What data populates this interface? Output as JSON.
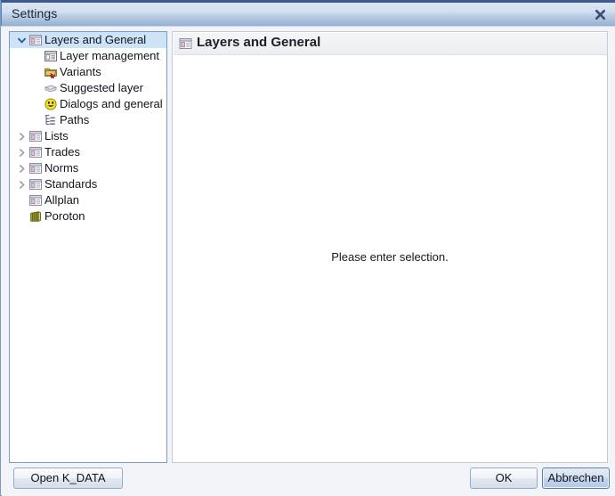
{
  "window": {
    "title": "Settings",
    "close_icon": "close-icon"
  },
  "tree": {
    "items": [
      {
        "label": "Layers and General",
        "icon": "window-layout-icon",
        "level": 0,
        "state": "expanded",
        "selected": true
      },
      {
        "label": "Layer management",
        "icon": "layer-management-icon",
        "level": 1,
        "state": "leaf",
        "selected": false
      },
      {
        "label": "Variants",
        "icon": "folder-variants-icon",
        "level": 1,
        "state": "leaf",
        "selected": false
      },
      {
        "label": "Suggested layer",
        "icon": "stacked-layers-icon",
        "level": 1,
        "state": "leaf",
        "selected": false
      },
      {
        "label": "Dialogs and general",
        "icon": "smiley-face-icon",
        "level": 1,
        "state": "leaf",
        "selected": false
      },
      {
        "label": "Paths",
        "icon": "paths-tree-icon",
        "level": 1,
        "state": "leaf",
        "selected": false
      },
      {
        "label": "Lists",
        "icon": "window-layout-icon",
        "level": 0,
        "state": "collapsed",
        "selected": false
      },
      {
        "label": "Trades",
        "icon": "window-layout-icon",
        "level": 0,
        "state": "collapsed",
        "selected": false
      },
      {
        "label": "Norms",
        "icon": "window-layout-icon",
        "level": 0,
        "state": "collapsed",
        "selected": false
      },
      {
        "label": "Standards",
        "icon": "window-layout-icon",
        "level": 0,
        "state": "collapsed",
        "selected": false
      },
      {
        "label": "Allplan",
        "icon": "window-layout-icon",
        "level": 0,
        "state": "leaf",
        "selected": false
      },
      {
        "label": "Poroton",
        "icon": "poroton-brick-icon",
        "level": 0,
        "state": "leaf",
        "selected": false
      }
    ]
  },
  "content": {
    "header_title": "Layers and General",
    "header_icon": "window-layout-icon",
    "message": "Please enter selection."
  },
  "footer": {
    "open_kdata_label": "Open K_DATA",
    "ok_label": "OK",
    "cancel_label": "Abbrechen"
  },
  "colors": {
    "selection": "#cde3f7",
    "titlebar_top_border": "#3c5a8f",
    "panel_border": "#7a9cc6"
  }
}
